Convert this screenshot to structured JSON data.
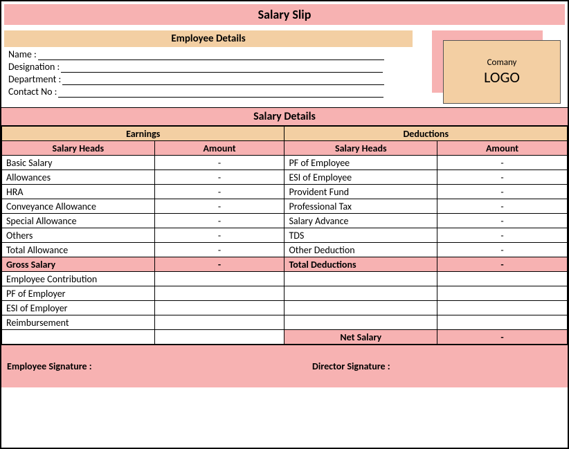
{
  "title": "Salary Slip",
  "employee_header": "Employee Details",
  "employee_fields": {
    "name": "Name :",
    "designation": "Designation :",
    "department": "Department :",
    "contact": "Contact No :"
  },
  "logo": {
    "line1": "Comany",
    "line2": "LOGO"
  },
  "salary_header": "Salary Details",
  "earnings_header": "Earnings",
  "deductions_header": "Deductions",
  "col_salary_heads": "Salary Heads",
  "col_amount": "Amount",
  "earnings": [
    {
      "label": "Basic Salary",
      "amount": "-"
    },
    {
      "label": "Allowances",
      "amount": "-"
    },
    {
      "label": "HRA",
      "amount": "-"
    },
    {
      "label": "Conveyance Allowance",
      "amount": "-"
    },
    {
      "label": "Special Allowance",
      "amount": "-"
    },
    {
      "label": "Others",
      "amount": "-"
    },
    {
      "label": "Total Allowance",
      "amount": "-"
    }
  ],
  "deductions": [
    {
      "label": "PF of Employee",
      "amount": "-"
    },
    {
      "label": "ESI of Employee",
      "amount": "-"
    },
    {
      "label": "Provident Fund",
      "amount": "-"
    },
    {
      "label": "Professional Tax",
      "amount": "-"
    },
    {
      "label": "Salary Advance",
      "amount": "-"
    },
    {
      "label": "TDS",
      "amount": "-"
    },
    {
      "label": "Other Deduction",
      "amount": "-"
    }
  ],
  "gross_salary_label": "Gross Salary",
  "gross_salary_amount": "-",
  "total_deductions_label": "Total Deductions",
  "total_deductions_amount": "-",
  "extra_rows": [
    "Employee Contribution",
    "PF of Employer",
    "ESI of Employer",
    "Reimbursement"
  ],
  "net_salary_label": "Net Salary",
  "net_salary_amount": "-",
  "sig_employee": "Employee Signature :",
  "sig_director": "Director Signature :"
}
